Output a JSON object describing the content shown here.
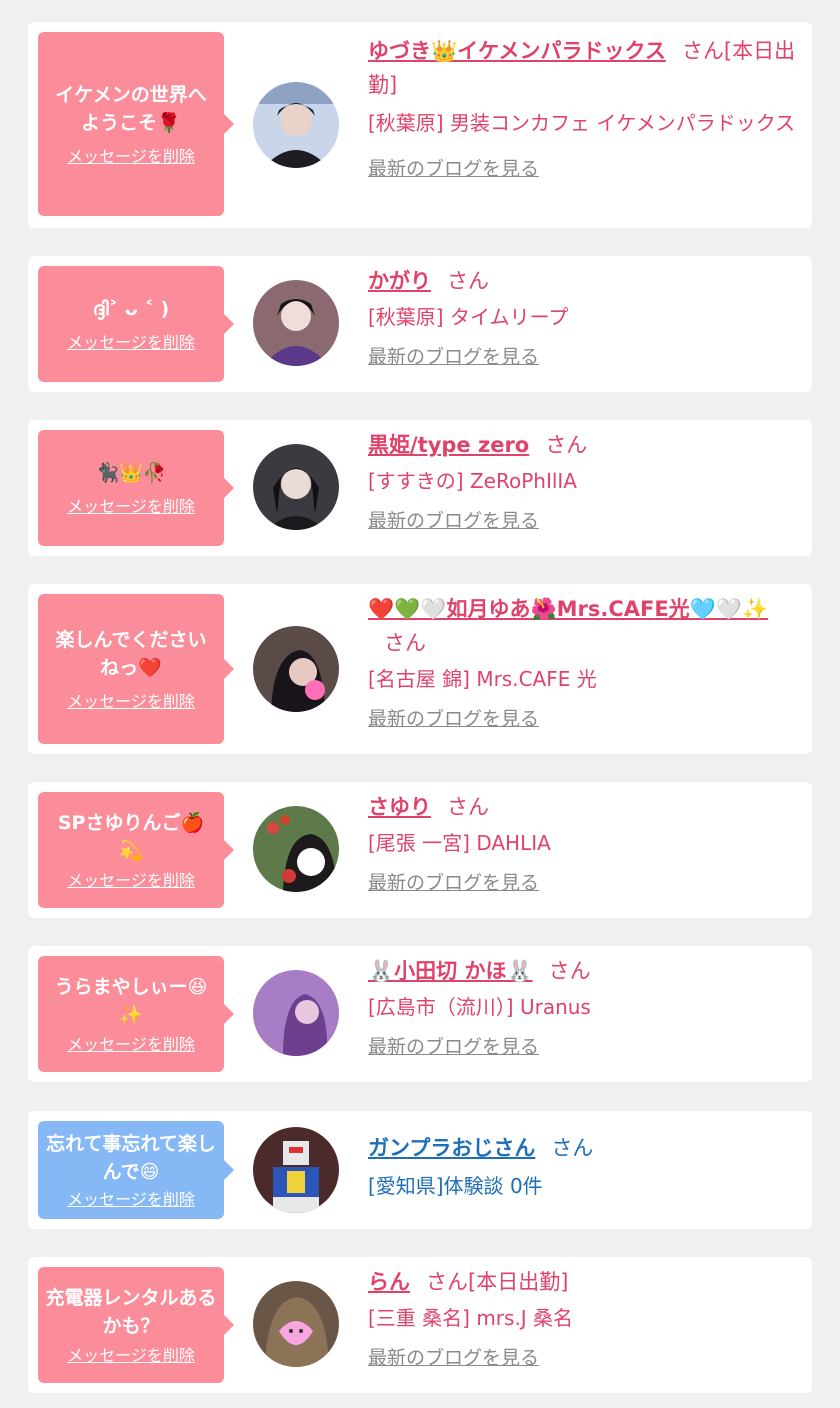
{
  "colors": {
    "background": "#f0f0f0",
    "card": "#ffffff",
    "bubble_pink": "#fb8c9a",
    "bubble_blue": "#86b8f5",
    "name_pink": "#e0436a",
    "name_blue": "#1f6fb8",
    "link_gray": "#8a8a8a"
  },
  "delete_label": "メッセージを削除",
  "blog_label": "最新のブログを見る",
  "items": [
    {
      "message": "イケメンの世界へようこそ🌹",
      "name": "ゆづき👑イケメンパラドックス",
      "suffix": "さん[本日出勤]",
      "shop": "[秋葉原] 男装コンカフェ イケメンパラドックス",
      "avatar_icon": "avatar-photo"
    },
    {
      "message": "ദ്ദി˃ ᴗ ˂ )",
      "name": "かがり",
      "suffix": "さん",
      "shop": "[秋葉原] タイムリープ",
      "avatar_icon": "avatar-photo"
    },
    {
      "message": "🐈‍⬛👑🥀",
      "name": "黒姫/type zero",
      "suffix": "さん",
      "shop": "[すすきの] ZeRoPhIlIA",
      "avatar_icon": "avatar-photo"
    },
    {
      "message": "楽しんでくださいねっ❤️",
      "name": "❤️💚🤍如月ゆあ🌺Mrs.CAFE光🩵🤍✨",
      "suffix": "さん",
      "shop": "[名古屋 錦] Mrs.CAFE 光",
      "avatar_icon": "avatar-photo"
    },
    {
      "message": "SPさゆりんご🍎💫",
      "name": "さゆり",
      "suffix": "さん",
      "shop": "[尾張 一宮] DAHLIA",
      "avatar_icon": "avatar-photo"
    },
    {
      "message": "うらまやしぃー😆✨",
      "name": "🐰小田切 かほ🐰",
      "suffix": "さん",
      "shop": "[広島市（流川）] Uranus",
      "avatar_icon": "avatar-photo"
    },
    {
      "message": "忘れて事忘れて楽しんで😄",
      "name": "ガンプラおじさん",
      "suffix": "さん",
      "shop": "[愛知県]体験談 0件",
      "avatar_icon": "avatar-photo"
    },
    {
      "message": "充電器レンタルあるかも？",
      "name": "らん",
      "suffix": "さん[本日出勤]",
      "shop": "[三重 桑名] mrs.J 桑名",
      "avatar_icon": "avatar-photo"
    }
  ]
}
